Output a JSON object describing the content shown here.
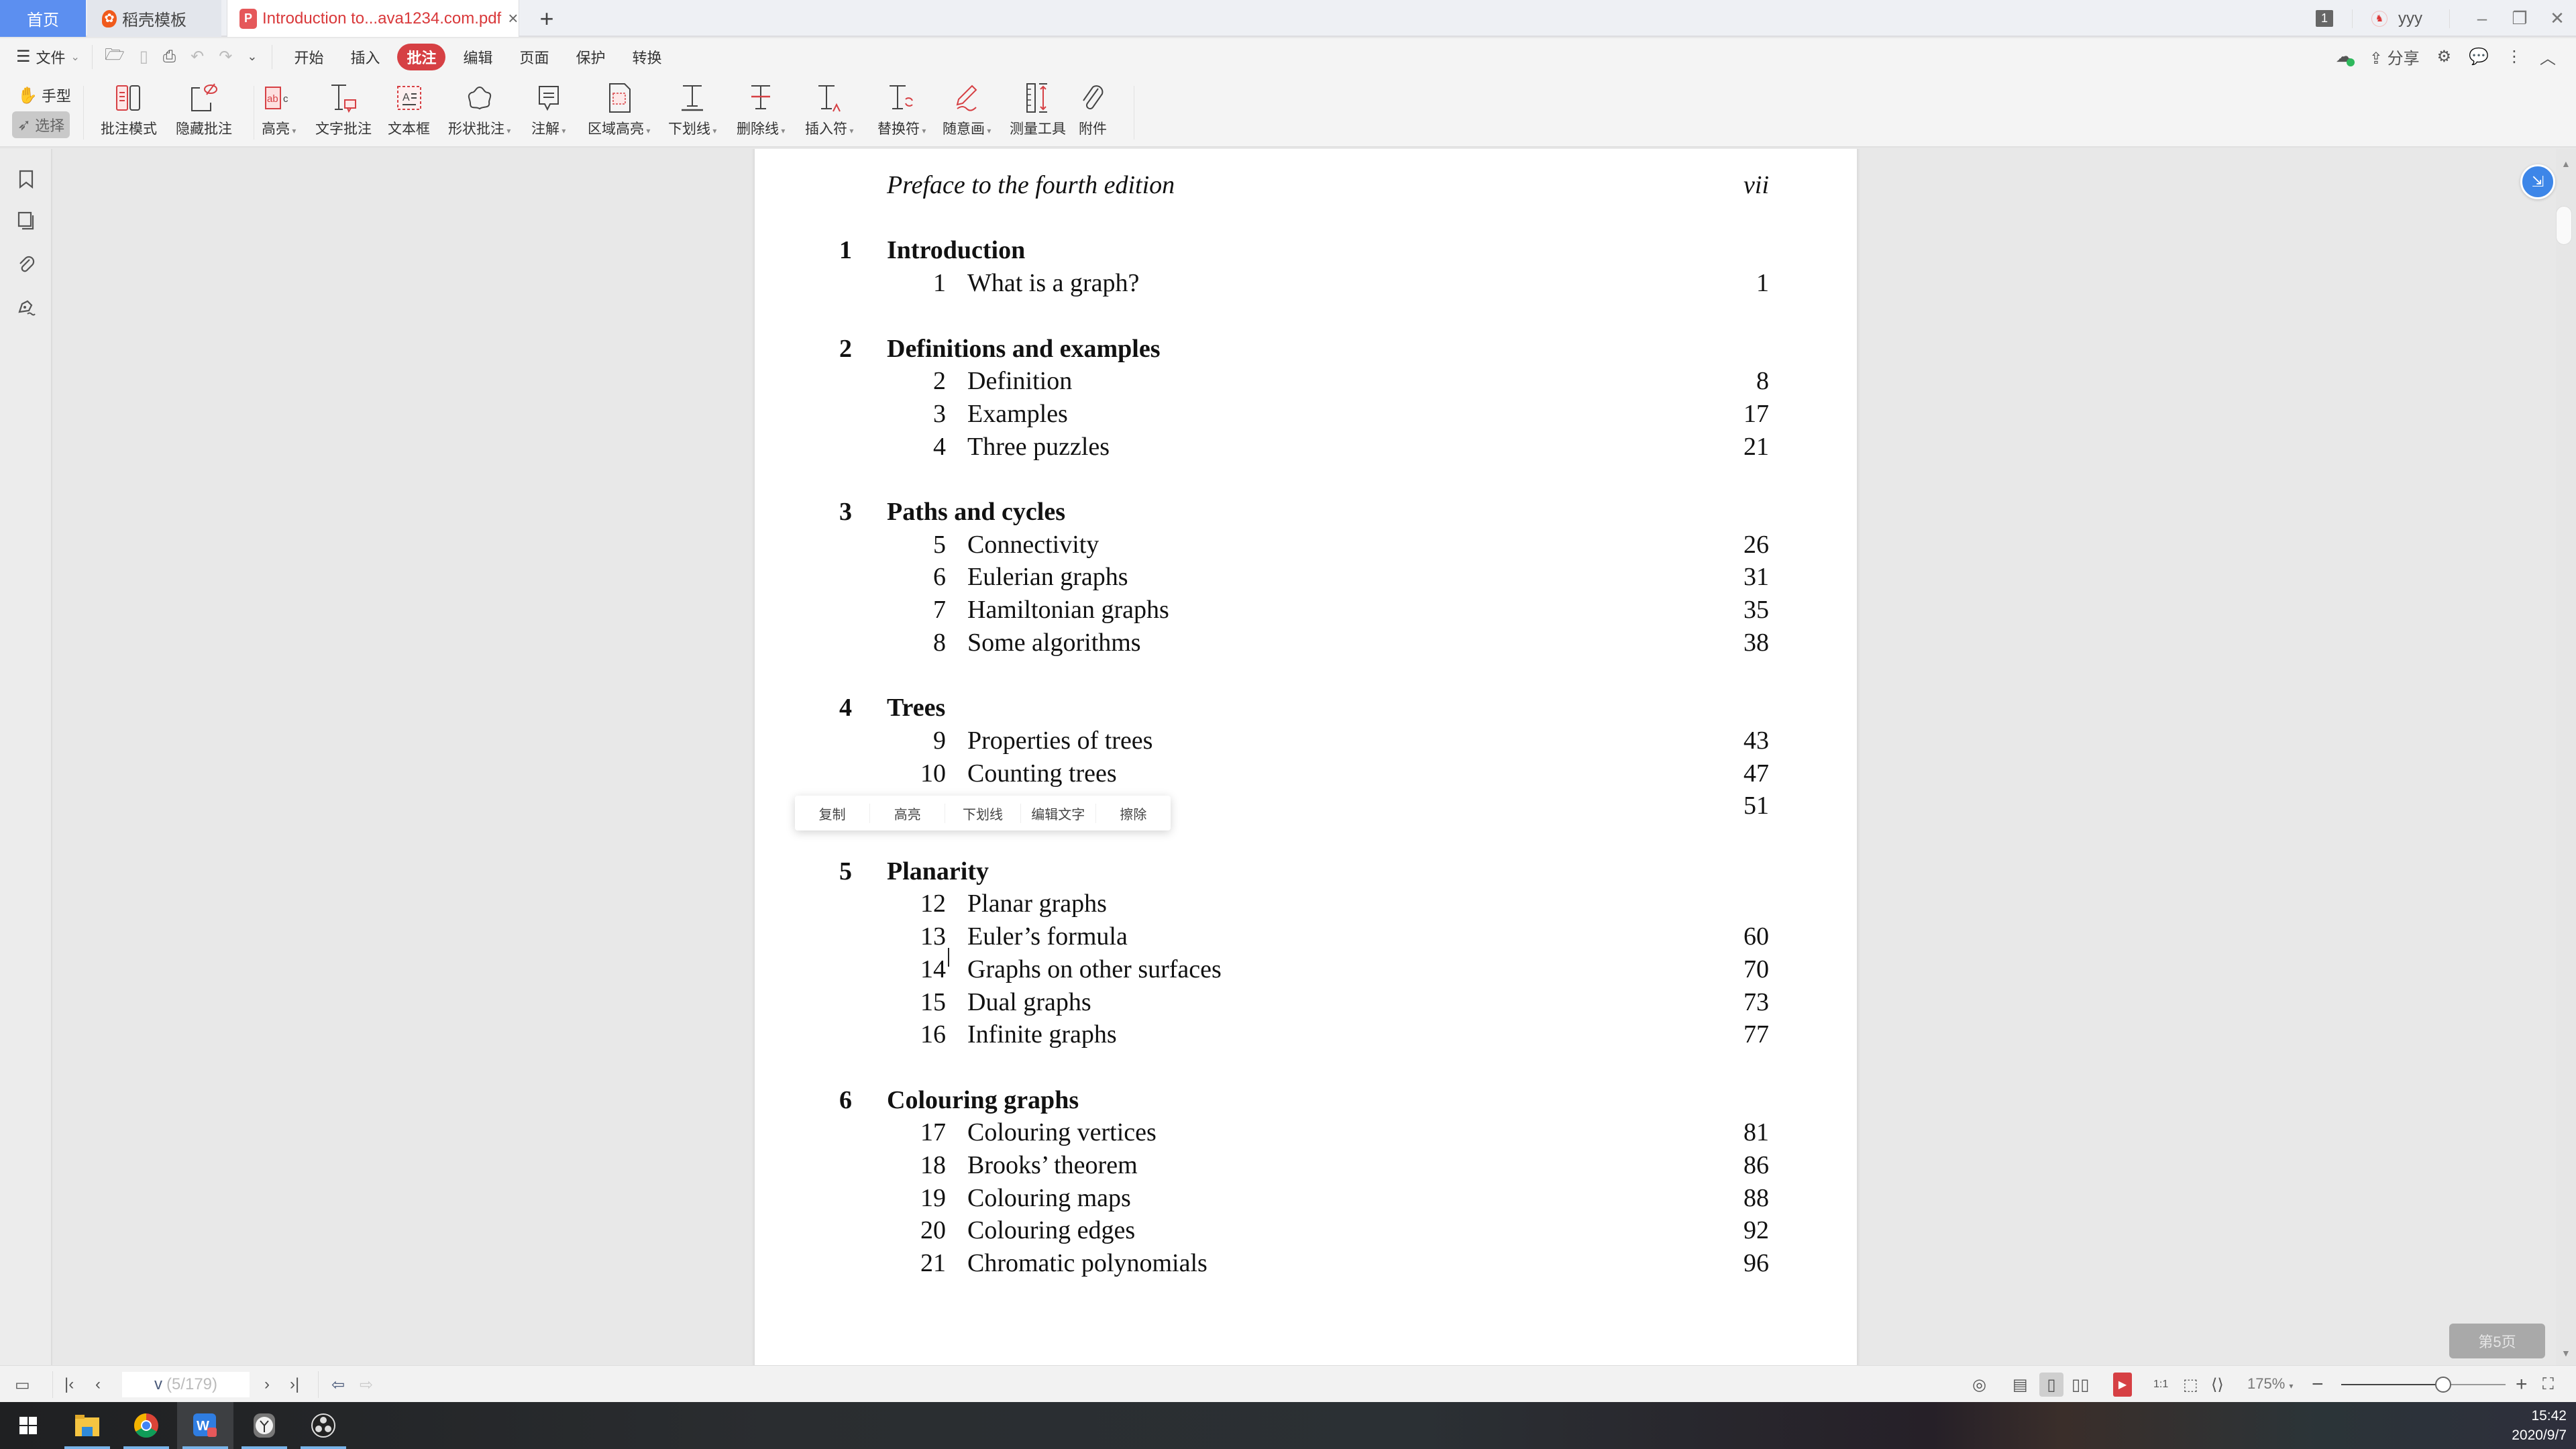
{
  "tabs": {
    "home": "首页",
    "template": "稻壳模板",
    "document": "Introduction to...ava1234.com.pdf",
    "add_label": "+"
  },
  "titlebar_right": {
    "window_count": "1",
    "user": "yyy"
  },
  "menu": {
    "file": "文件",
    "items": [
      "开始",
      "插入",
      "批注",
      "编辑",
      "页面",
      "保护",
      "转换"
    ],
    "active": "批注",
    "share": "分享"
  },
  "ribbon": {
    "hand": "手型",
    "select": "选择",
    "buttons": [
      {
        "label": "批注模式",
        "icon": "annotation-mode-icon",
        "dropdown": false
      },
      {
        "label": "隐藏批注",
        "icon": "hide-annotation-icon",
        "dropdown": false
      },
      {
        "label": "高亮",
        "icon": "highlight-icon",
        "dropdown": true
      },
      {
        "label": "文字批注",
        "icon": "text-comment-icon",
        "dropdown": false
      },
      {
        "label": "文本框",
        "icon": "text-box-icon",
        "dropdown": false
      },
      {
        "label": "形状批注",
        "icon": "shape-annotation-icon",
        "dropdown": true
      },
      {
        "label": "注解",
        "icon": "note-icon",
        "dropdown": true
      },
      {
        "label": "区域高亮",
        "icon": "area-highlight-icon",
        "dropdown": true
      },
      {
        "label": "下划线",
        "icon": "underline-icon",
        "dropdown": true
      },
      {
        "label": "删除线",
        "icon": "strikethrough-icon",
        "dropdown": true
      },
      {
        "label": "插入符",
        "icon": "insert-caret-icon",
        "dropdown": true
      },
      {
        "label": "替换符",
        "icon": "replace-icon",
        "dropdown": true
      },
      {
        "label": "随意画",
        "icon": "freehand-pen-icon",
        "dropdown": true
      },
      {
        "label": "测量工具",
        "icon": "measure-icon",
        "dropdown": false
      },
      {
        "label": "附件",
        "icon": "attachment-icon",
        "dropdown": false
      }
    ]
  },
  "toc": {
    "preface": {
      "title": "Preface to the fourth edition",
      "page": "vii"
    },
    "chapters": [
      {
        "num": "1",
        "title": "Introduction",
        "sections": [
          {
            "num": "1",
            "title": "What is a graph?",
            "page": "1"
          }
        ]
      },
      {
        "num": "2",
        "title": "Definitions and examples",
        "sections": [
          {
            "num": "2",
            "title": "Definition",
            "page": "8"
          },
          {
            "num": "3",
            "title": "Examples",
            "page": "17"
          },
          {
            "num": "4",
            "title": "Three puzzles",
            "page": "21"
          }
        ]
      },
      {
        "num": "3",
        "title": "Paths and cycles",
        "sections": [
          {
            "num": "5",
            "title": "Connectivity",
            "page": "26"
          },
          {
            "num": "6",
            "title": "Eulerian graphs",
            "page": "31"
          },
          {
            "num": "7",
            "title": "Hamiltonian graphs",
            "page": "35"
          },
          {
            "num": "8",
            "title": "Some algorithms",
            "page": "38"
          }
        ]
      },
      {
        "num": "4",
        "title": "Trees",
        "sections": [
          {
            "num": "9",
            "title": "Properties of trees",
            "page": "43"
          },
          {
            "num": "10",
            "title": "Counting trees",
            "page": "47"
          },
          {
            "num": "",
            "title": "",
            "page": "51"
          }
        ]
      },
      {
        "num": "5",
        "title": "Planarity",
        "sections": [
          {
            "num": "12",
            "title": "Planar graphs",
            "page": ""
          },
          {
            "num": "13",
            "title": "Euler’s formula",
            "page": "60"
          },
          {
            "num": "14",
            "title": "Graphs on other surfaces",
            "page": "70"
          },
          {
            "num": "15",
            "title": "Dual graphs",
            "page": "73"
          },
          {
            "num": "16",
            "title": "Infinite graphs",
            "page": "77"
          }
        ]
      },
      {
        "num": "6",
        "title": "Colouring graphs",
        "sections": [
          {
            "num": "17",
            "title": "Colouring vertices",
            "page": "81"
          },
          {
            "num": "18",
            "title": "Brooks’ theorem",
            "page": "86"
          },
          {
            "num": "19",
            "title": "Colouring maps",
            "page": "88"
          },
          {
            "num": "20",
            "title": "Colouring edges",
            "page": "92"
          },
          {
            "num": "21",
            "title": "Chromatic polynomials",
            "page": "96"
          }
        ]
      }
    ]
  },
  "selection_popup": [
    "复制",
    "高亮",
    "下划线",
    "编辑文字",
    "擦除"
  ],
  "page_indicator": "第5页",
  "statusbar": {
    "page_label": "v",
    "page_total": "(5/179)",
    "zoom": "175%",
    "zoom_slider_fraction": 0.62
  },
  "taskbar": {
    "apps": [
      "file-explorer",
      "chrome",
      "wps-office",
      "alarm-clock",
      "obs-studio"
    ],
    "active_app": "wps-office",
    "time": "15:42",
    "date": "2020/9/7"
  },
  "colors": {
    "accent_red": "#d64044",
    "home_tab_blue": "#5c8ff0",
    "float_button_blue": "#3d86e8"
  }
}
